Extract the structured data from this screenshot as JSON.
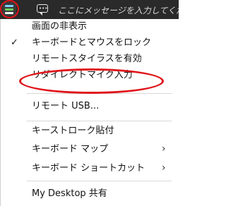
{
  "toolbar": {
    "app_icon": "remote-desktop-app-icon",
    "chat_icon": "chat-bubble-icon",
    "chat_placeholder": "ここにメッセージを入力してくだ"
  },
  "menu": {
    "items": [
      {
        "label": "画面の非表示",
        "checked": false,
        "submenu": false
      },
      {
        "label": "キーボードとマウスをロック",
        "checked": true,
        "submenu": false
      },
      {
        "label": "リモートスタイラスを有効",
        "checked": false,
        "submenu": false
      },
      {
        "label": "リダイレクトマイク入力",
        "checked": false,
        "submenu": false,
        "highlighted": true
      },
      {
        "label": "リモート USB...",
        "checked": false,
        "submenu": false
      },
      {
        "label": "キーストローク貼付",
        "checked": false,
        "submenu": false
      },
      {
        "label": "キーボード マップ",
        "checked": false,
        "submenu": true
      },
      {
        "label": "キーボード ショートカット",
        "checked": false,
        "submenu": true
      },
      {
        "label": "My Desktop 共有",
        "checked": false,
        "submenu": false
      }
    ],
    "check_glyph": "✓",
    "arrow_glyph": "›"
  },
  "colors": {
    "annotation": "#e0151b",
    "topbar": "#2a2a2a"
  }
}
